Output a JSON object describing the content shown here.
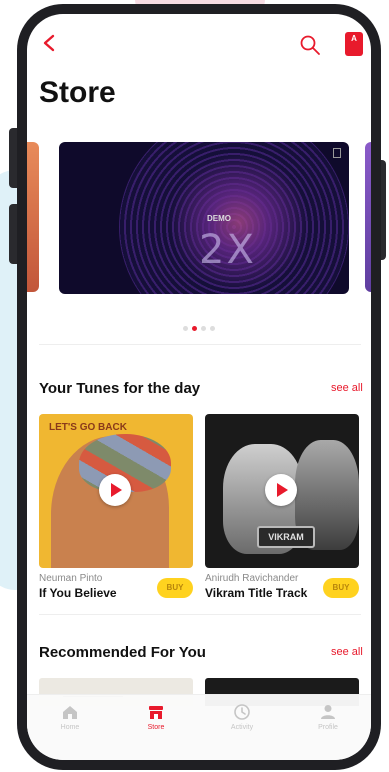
{
  "colors": {
    "accent": "#e81a2c",
    "buy": "#ffd21f",
    "frame": "#1f1f23"
  },
  "header": {
    "title": "Store",
    "back_icon": "chevron-left-icon",
    "search_icon": "search-icon",
    "account_badge": "A"
  },
  "carousel": {
    "banner_tag": "DEMO",
    "banner_big_text": "2X",
    "page_count": 4,
    "active_page": 2
  },
  "tunes_section": {
    "title": "Your Tunes for the day",
    "see_all": "see all",
    "items": [
      {
        "artist": "Neuman Pinto",
        "song": "If You Believe",
        "art_text": "LET'S GO BACK",
        "buy_label": "BUY"
      },
      {
        "artist": "Anirudh Ravichander",
        "song": "Vikram Title Track",
        "art_text": "VIKRAM",
        "buy_label": "BUY"
      }
    ]
  },
  "recommended_section": {
    "title": "Recommended For You",
    "see_all": "see all"
  },
  "tabbar": {
    "items": [
      {
        "label": "Home",
        "icon": "home-icon",
        "active": false
      },
      {
        "label": "Store",
        "icon": "store-icon",
        "active": true
      },
      {
        "label": "Activity",
        "icon": "clock-icon",
        "active": false
      },
      {
        "label": "Profile",
        "icon": "person-icon",
        "active": false
      }
    ]
  }
}
